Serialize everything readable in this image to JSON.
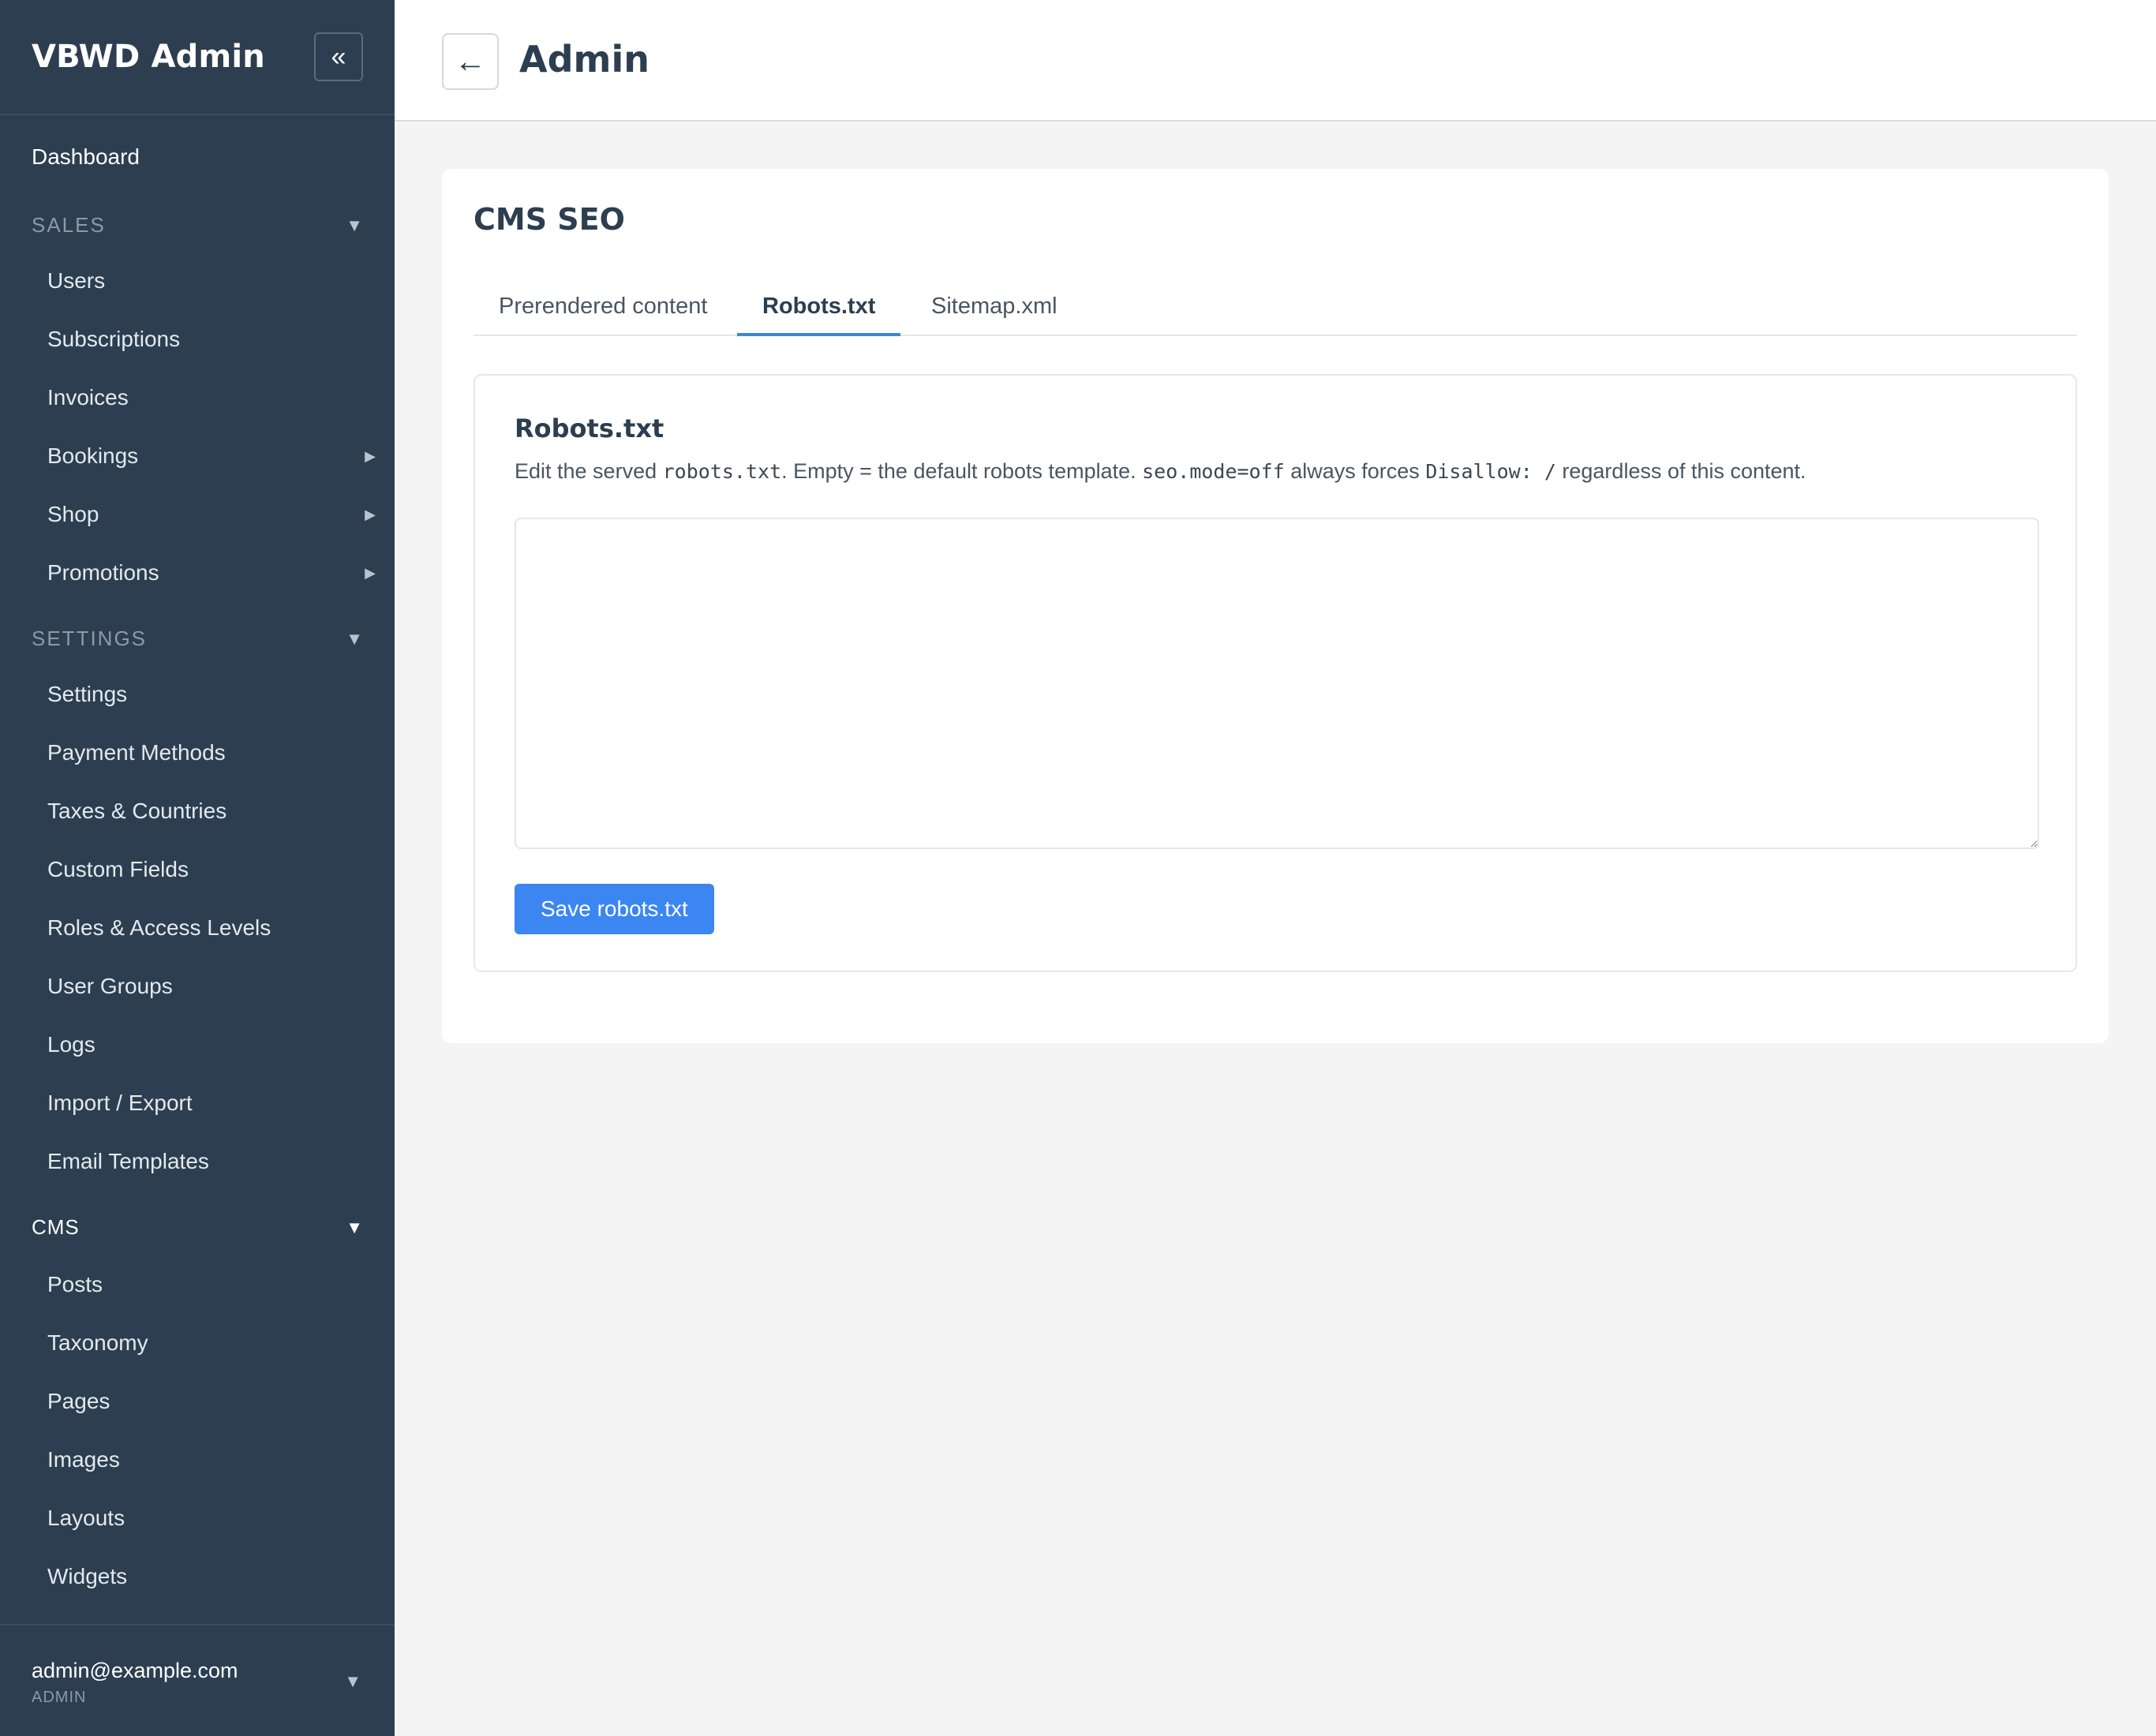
{
  "sidebar": {
    "brand": "VBWD Admin",
    "collapse_icon": "«",
    "dashboard": "Dashboard",
    "sections": {
      "sales": {
        "label": "SALES",
        "items": [
          "Users",
          "Subscriptions",
          "Invoices",
          "Bookings",
          "Shop",
          "Promotions"
        ]
      },
      "settings": {
        "label": "SETTINGS",
        "items": [
          "Settings",
          "Payment Methods",
          "Taxes & Countries",
          "Custom Fields",
          "Roles & Access Levels",
          "User Groups",
          "Logs",
          "Import / Export",
          "Email Templates"
        ]
      },
      "cms": {
        "label": "CMS",
        "items": [
          "Posts",
          "Taxonomy",
          "Pages",
          "Images",
          "Layouts",
          "Widgets"
        ]
      }
    },
    "caret_down": "▼",
    "caret_right": "▶",
    "user": {
      "email": "admin@example.com",
      "role": "ADMIN"
    }
  },
  "header": {
    "back_icon": "←",
    "title": "Admin"
  },
  "main": {
    "title": "CMS SEO",
    "tabs": [
      {
        "label": "Prerendered content",
        "active": false
      },
      {
        "label": "Robots.txt",
        "active": true
      },
      {
        "label": "Sitemap.xml",
        "active": false
      }
    ],
    "panel": {
      "title": "Robots.txt",
      "desc": {
        "p1": "Edit the served ",
        "c1": "robots.txt",
        "p2": ". Empty = the default robots template. ",
        "c2": "seo.mode=off",
        "p3": " always forces ",
        "c3": "Disallow: /",
        "p4": " regardless of this content."
      },
      "textarea_value": "",
      "save_label": "Save robots.txt"
    }
  },
  "colors": {
    "sidebar_bg": "#2d3e50",
    "accent": "#3b86f0",
    "tab_underline": "#3b86d8",
    "page_bg": "#f4f4f4"
  }
}
